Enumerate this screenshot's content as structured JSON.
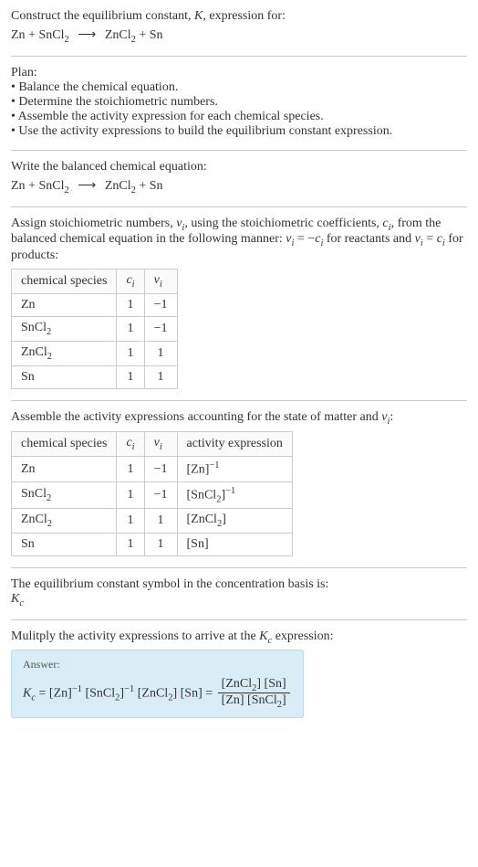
{
  "intro": {
    "line1_prefix": "Construct the equilibrium constant, ",
    "line1_K": "K",
    "line1_suffix": ", expression for:",
    "eq_lhs1": "Zn",
    "eq_plus": " + ",
    "eq_lhs2": "SnCl",
    "eq_lhs2_sub": "2",
    "eq_arrow": "⟶",
    "eq_rhs1": "ZnCl",
    "eq_rhs1_sub": "2",
    "eq_rhs2": "Sn"
  },
  "plan": {
    "title": "Plan:",
    "items": [
      "Balance the chemical equation.",
      "Determine the stoichiometric numbers.",
      "Assemble the activity expression for each chemical species.",
      "Use the activity expressions to build the equilibrium constant expression."
    ]
  },
  "balanced": {
    "title": "Write the balanced chemical equation:"
  },
  "stoich": {
    "text_a": "Assign stoichiometric numbers, ",
    "nu_i": "ν",
    "sub_i": "i",
    "text_b": ", using the stoichiometric coefficients, ",
    "c_i": "c",
    "text_c": ", from the balanced chemical equation in the following manner: ",
    "rel1_a": "ν",
    "rel1_b": " = −",
    "rel1_c": "c",
    "text_d": " for reactants and ",
    "rel2_a": "ν",
    "rel2_b": " = ",
    "rel2_c": "c",
    "text_e": " for products:",
    "headers": {
      "species": "chemical species",
      "ci": "c",
      "ci_sub": "i",
      "nui": "ν",
      "nui_sub": "i"
    },
    "rows": [
      {
        "species": "Zn",
        "sub": "",
        "ci": "1",
        "nui": "−1"
      },
      {
        "species": "SnCl",
        "sub": "2",
        "ci": "1",
        "nui": "−1"
      },
      {
        "species": "ZnCl",
        "sub": "2",
        "ci": "1",
        "nui": "1"
      },
      {
        "species": "Sn",
        "sub": "",
        "ci": "1",
        "nui": "1"
      }
    ]
  },
  "activity": {
    "title_a": "Assemble the activity expressions accounting for the state of matter and ",
    "title_nu": "ν",
    "title_sub": "i",
    "title_b": ":",
    "headers": {
      "species": "chemical species",
      "ci": "c",
      "ci_sub": "i",
      "nui": "ν",
      "nui_sub": "i",
      "act": "activity expression"
    },
    "rows": [
      {
        "species": "Zn",
        "sub": "",
        "ci": "1",
        "nui": "−1",
        "act_base": "[Zn]",
        "act_exp": "−1"
      },
      {
        "species": "SnCl",
        "sub": "2",
        "ci": "1",
        "nui": "−1",
        "act_base": "[SnCl",
        "act_base_sub": "2",
        "act_close": "]",
        "act_exp": "−1"
      },
      {
        "species": "ZnCl",
        "sub": "2",
        "ci": "1",
        "nui": "1",
        "act_base": "[ZnCl",
        "act_base_sub": "2",
        "act_close": "]",
        "act_exp": ""
      },
      {
        "species": "Sn",
        "sub": "",
        "ci": "1",
        "nui": "1",
        "act_base": "[Sn]",
        "act_exp": ""
      }
    ]
  },
  "symbol": {
    "line1": "The equilibrium constant symbol in the concentration basis is:",
    "Kc": "K",
    "Kc_sub": "c"
  },
  "multiply": {
    "text_a": "Mulitply the activity expressions to arrive at the ",
    "Kc": "K",
    "Kc_sub": "c",
    "text_b": " expression:"
  },
  "answer": {
    "label": "Answer:",
    "Kc": "K",
    "Kc_sub": "c",
    "eq": " = ",
    "t1": "[Zn]",
    "t1_exp": "−1",
    "sp": " ",
    "t2_a": "[SnCl",
    "t2_sub": "2",
    "t2_b": "]",
    "t2_exp": "−1",
    "t3_a": "[ZnCl",
    "t3_sub": "2",
    "t3_b": "]",
    "t4": "[Sn]",
    "eq2": " = ",
    "num_a": "[ZnCl",
    "num_sub": "2",
    "num_b": "] [Sn]",
    "den_a": "[Zn] [SnCl",
    "den_sub": "2",
    "den_b": "]"
  },
  "chart_data": {
    "type": "table",
    "tables": [
      {
        "title": "Stoichiometric numbers",
        "columns": [
          "chemical species",
          "c_i",
          "ν_i"
        ],
        "rows": [
          [
            "Zn",
            1,
            -1
          ],
          [
            "SnCl2",
            1,
            -1
          ],
          [
            "ZnCl2",
            1,
            1
          ],
          [
            "Sn",
            1,
            1
          ]
        ]
      },
      {
        "title": "Activity expressions",
        "columns": [
          "chemical species",
          "c_i",
          "ν_i",
          "activity expression"
        ],
        "rows": [
          [
            "Zn",
            1,
            -1,
            "[Zn]^-1"
          ],
          [
            "SnCl2",
            1,
            -1,
            "[SnCl2]^-1"
          ],
          [
            "ZnCl2",
            1,
            1,
            "[ZnCl2]"
          ],
          [
            "Sn",
            1,
            1,
            "[Sn]"
          ]
        ]
      }
    ]
  }
}
